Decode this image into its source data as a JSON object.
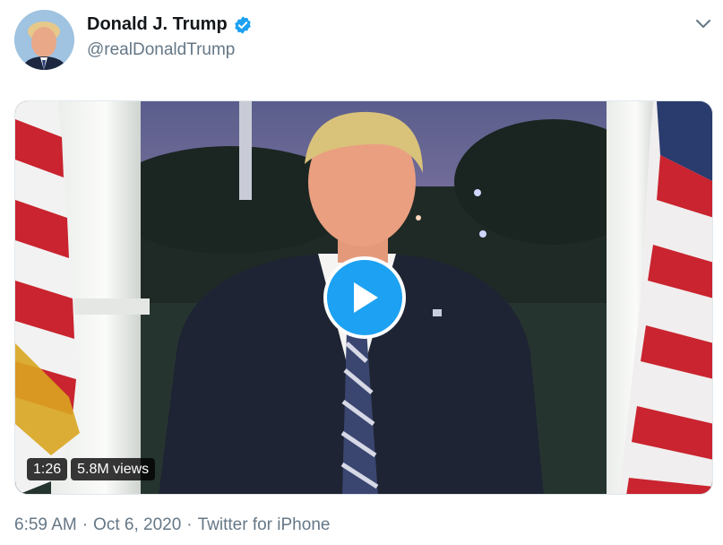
{
  "tweet": {
    "author": {
      "display_name": "Donald J. Trump",
      "handle": "@realDonaldTrump",
      "verified": true,
      "avatar_icon": "profile-photo"
    },
    "menu_icon": "chevron-down-icon",
    "media": {
      "type": "video",
      "play_icon": "play-icon",
      "duration": "1:26",
      "views": "5.8M views"
    },
    "time": "6:59 AM",
    "date": "Oct 6, 2020",
    "source": "Twitter for iPhone",
    "separator": "·"
  },
  "colors": {
    "accent": "#1da1f2",
    "text_primary": "#14171a",
    "text_secondary": "#657786"
  }
}
